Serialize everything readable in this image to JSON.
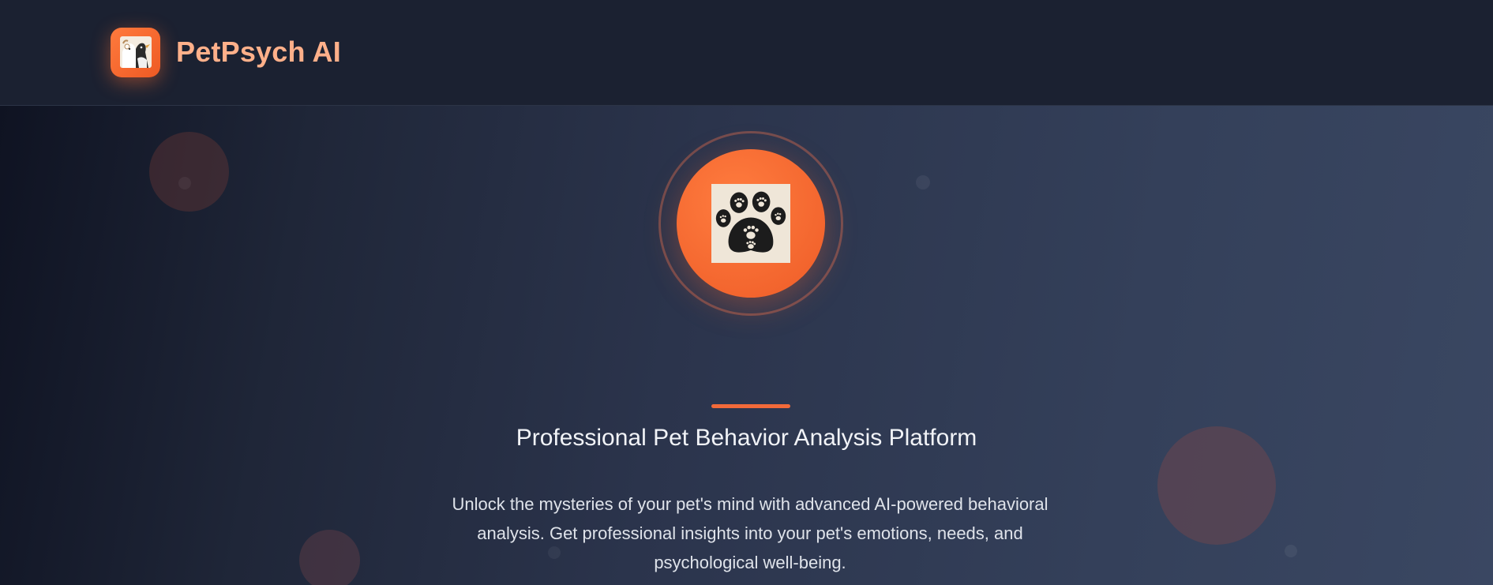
{
  "header": {
    "brand_name": "PetPsych AI",
    "logo_icon": "pet-portrait-icon"
  },
  "hero": {
    "icon": "paw-prints-icon",
    "title": "Professional Pet Behavior Analysis Platform",
    "description": "Unlock the mysteries of your pet's mind with advanced AI-powered behavioral analysis. Get professional insights into your pet's emotions, needs, and psychological well-being."
  },
  "colors": {
    "accent": "#ee5c27",
    "brand_text": "#ffb08a",
    "header_bg": "#1b2131",
    "hero_bg_end": "#3a4762"
  }
}
